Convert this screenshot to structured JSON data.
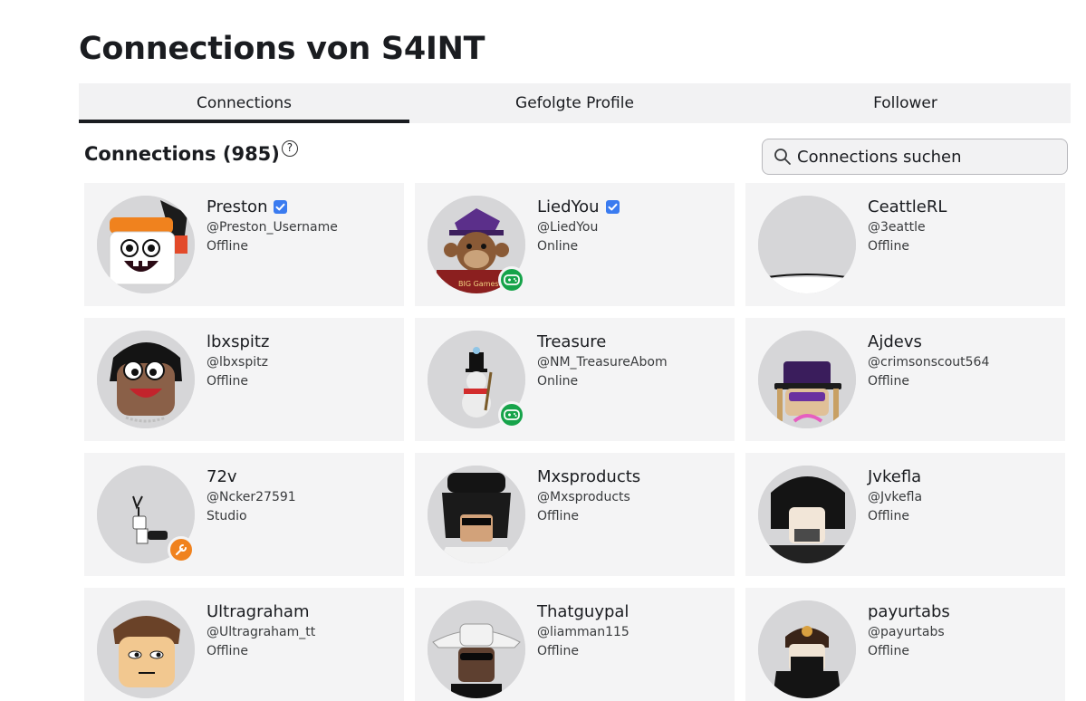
{
  "page": {
    "title": "Connections von S4INT"
  },
  "tabs": [
    {
      "label": "Connections",
      "active": true
    },
    {
      "label": "Gefolgte Profile",
      "active": false
    },
    {
      "label": "Follower",
      "active": false
    }
  ],
  "section": {
    "title": "Connections (985)",
    "help_glyph": "?"
  },
  "search": {
    "placeholder": "Connections suchen",
    "value": ""
  },
  "colors": {
    "online": "#16a34a",
    "studio": "#f0821e",
    "verified": "#3a7bf0"
  },
  "connections": [
    {
      "name": "Preston",
      "handle": "@Preston_Username",
      "status": "Offline",
      "verified": true,
      "badge": "none"
    },
    {
      "name": "LiedYou",
      "handle": "@LiedYou",
      "status": "Online",
      "verified": true,
      "badge": "game-controller-icon"
    },
    {
      "name": "CeattleRL",
      "handle": "@3eattle",
      "status": "Offline",
      "verified": false,
      "badge": "none"
    },
    {
      "name": "lbxspitz",
      "handle": "@lbxspitz",
      "status": "Offline",
      "verified": false,
      "badge": "none"
    },
    {
      "name": "Treasure",
      "handle": "@NM_TreasureAbom",
      "status": "Online",
      "verified": false,
      "badge": "game-controller-icon"
    },
    {
      "name": "Ajdevs",
      "handle": "@crimsonscout564",
      "status": "Offline",
      "verified": false,
      "badge": "none"
    },
    {
      "name": "72v",
      "handle": "@Ncker27591",
      "status": "Studio",
      "verified": false,
      "badge": "wrench-icon"
    },
    {
      "name": "Mxsproducts",
      "handle": "@Mxsproducts",
      "status": "Offline",
      "verified": false,
      "badge": "none"
    },
    {
      "name": "Jvkefla",
      "handle": "@Jvkefla",
      "status": "Offline",
      "verified": false,
      "badge": "none"
    },
    {
      "name": "Ultragraham",
      "handle": "@Ultragraham_tt",
      "status": "Offline",
      "verified": false,
      "badge": "none"
    },
    {
      "name": "Thatguypal",
      "handle": "@liamman115",
      "status": "Offline",
      "verified": false,
      "badge": "none"
    },
    {
      "name": "payurtabs",
      "handle": "@payurtabs",
      "status": "Offline",
      "verified": false,
      "badge": "none"
    }
  ]
}
